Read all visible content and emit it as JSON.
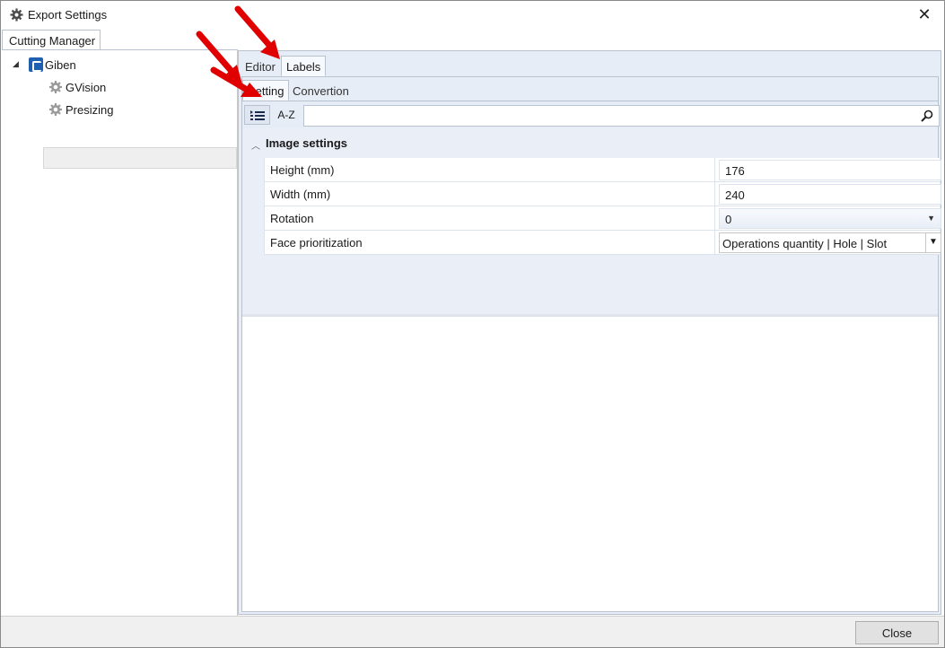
{
  "window": {
    "title": "Export Settings",
    "close_symbol": "✕"
  },
  "left": {
    "tab_label": "Cutting Manager",
    "tree": {
      "root_label": "Giben",
      "children": [
        {
          "label": "GVision",
          "icon": "gear-icon"
        },
        {
          "label": "Presizing",
          "icon": "gear-icon",
          "selected": true
        }
      ]
    }
  },
  "right": {
    "top_tabs": [
      {
        "label": "Editor",
        "active": false
      },
      {
        "label": "Labels",
        "active": true
      }
    ],
    "sub_tabs": [
      {
        "label": "Setting",
        "active": true
      },
      {
        "label": "Convertion",
        "active": false
      }
    ],
    "toolbar": {
      "categorized_icon": "categorized-list-icon",
      "az_label": "A-Z",
      "search_placeholder": "",
      "search_icon": "search-icon"
    },
    "group": {
      "title": "Image settings",
      "expanded": true,
      "rows": [
        {
          "name": "Height (mm)",
          "value": "176",
          "type": "text"
        },
        {
          "name": "Width (mm)",
          "value": "240",
          "type": "text"
        },
        {
          "name": "Rotation",
          "value": "0",
          "type": "select"
        },
        {
          "name": "Face prioritization",
          "value": "Operations quantity | Hole | Slot",
          "type": "select"
        }
      ]
    }
  },
  "footer": {
    "close_label": "Close"
  },
  "colors": {
    "accent_blue": "#1f5fb0",
    "panel_bg": "#e7edf6",
    "annotation_arrow": "#e00000"
  }
}
